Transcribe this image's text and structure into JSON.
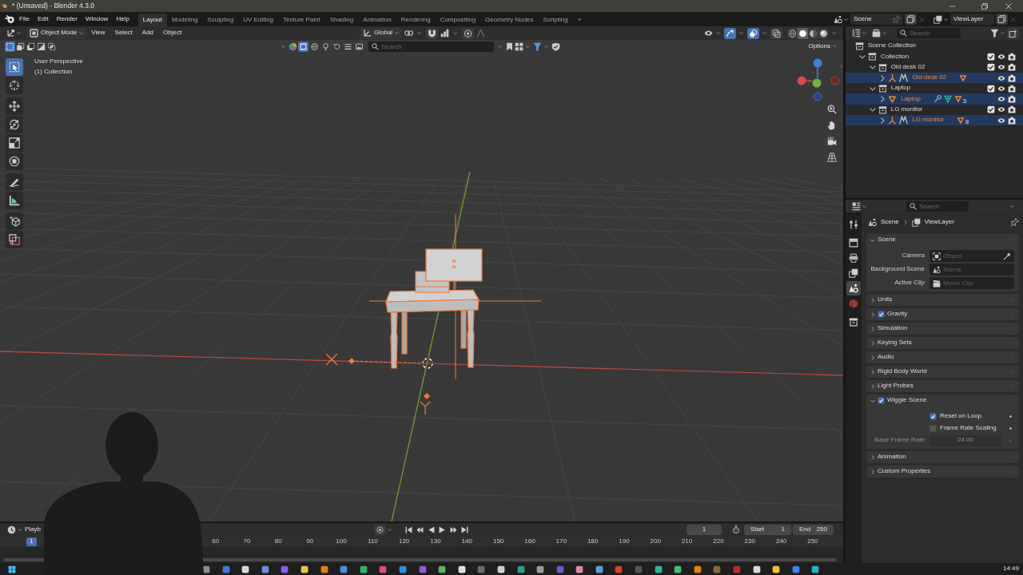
{
  "window": {
    "title": "* (Unsaved) - Blender 4.3.0"
  },
  "menu": [
    "File",
    "Edit",
    "Render",
    "Window",
    "Help"
  ],
  "workspaces": [
    {
      "label": "Layout",
      "selected": true
    },
    {
      "label": "Modeling",
      "selected": false
    },
    {
      "label": "Sculpting",
      "selected": false
    },
    {
      "label": "UV Editing",
      "selected": false
    },
    {
      "label": "Texture Paint",
      "selected": false
    },
    {
      "label": "Shading",
      "selected": false
    },
    {
      "label": "Animation",
      "selected": false
    },
    {
      "label": "Rendering",
      "selected": false
    },
    {
      "label": "Compositing",
      "selected": false
    },
    {
      "label": "Geometry Nodes",
      "selected": false
    },
    {
      "label": "Scripting",
      "selected": false
    }
  ],
  "add_workspace": "+",
  "scene_selector": {
    "scene": "Scene",
    "view_layer": "ViewLayer"
  },
  "viewport": {
    "mode": "Object Mode",
    "menus": [
      "View",
      "Select",
      "Add",
      "Object"
    ],
    "orientation": "Global",
    "toggles": [
      {
        "kind": "gizmos",
        "on": true
      },
      {
        "kind": "overlays",
        "on": true
      },
      {
        "kind": "xray",
        "on": false
      }
    ],
    "shading": [
      {
        "kind": "wireframe",
        "selected": false
      },
      {
        "kind": "solid",
        "selected": true
      },
      {
        "kind": "material",
        "selected": false
      },
      {
        "kind": "rendered",
        "selected": false
      }
    ],
    "select_modes": [
      {
        "kind": "set",
        "selected": true
      },
      {
        "kind": "extend",
        "selected": false
      },
      {
        "kind": "subtract",
        "selected": false
      },
      {
        "kind": "invert",
        "selected": false
      },
      {
        "kind": "intersect",
        "selected": false
      }
    ],
    "object_filters": [
      {
        "kind": "box",
        "selected": true
      },
      {
        "kind": "sphere",
        "selected": false
      },
      {
        "kind": "light",
        "selected": false
      },
      {
        "kind": "curve",
        "selected": false
      },
      {
        "kind": "group",
        "selected": false
      },
      {
        "kind": "image",
        "selected": false
      }
    ],
    "search": {
      "placeholder": "Search"
    },
    "options": "Options",
    "info": [
      "User Perspective",
      "(1) Collection"
    ],
    "tool_groups": [
      [
        {
          "kind": "select_box",
          "selected": true
        },
        {
          "kind": "cursor",
          "selected": false
        }
      ],
      [
        {
          "kind": "move",
          "selected": false
        },
        {
          "kind": "rotate",
          "selected": false
        },
        {
          "kind": "scale",
          "selected": false
        },
        {
          "kind": "transform",
          "selected": false
        }
      ],
      [
        {
          "kind": "annotate",
          "selected": false
        },
        {
          "kind": "measure",
          "selected": false
        }
      ],
      [
        {
          "kind": "add_cube",
          "selected": false
        },
        {
          "kind": "cube_tool",
          "selected": false
        }
      ]
    ]
  },
  "outliner": {
    "search": {
      "placeholder": "Search"
    },
    "tree": [
      {
        "label": "Scene Collection",
        "kind": "scene_collection",
        "selected": false,
        "children": [
          {
            "label": "Collection",
            "kind": "collection",
            "selected": false,
            "expanded": true,
            "checked": true,
            "children": [
              {
                "label": "Old desk 02",
                "kind": "collection",
                "selected": false,
                "expanded": true,
                "checked": true,
                "children": [
                  {
                    "label": "Old desk 02",
                    "kind": "empty",
                    "selected": true,
                    "expanded": false,
                    "data": [
                      {
                        "kind": "mesh"
                      }
                    ]
                  }
                ]
              },
              {
                "label": "Laptop",
                "kind": "collection",
                "selected": false,
                "expanded": true,
                "checked": true,
                "children": [
                  {
                    "label": "Laptop",
                    "kind": "mesh",
                    "selected": true,
                    "expanded": false,
                    "data": [
                      {
                        "kind": "modifier"
                      },
                      {
                        "kind": "vertex_groups"
                      },
                      {
                        "kind": "mesh",
                        "count": "3"
                      }
                    ]
                  }
                ]
              },
              {
                "label": "LG monitor",
                "kind": "collection",
                "selected": false,
                "expanded": true,
                "checked": true,
                "children": [
                  {
                    "label": "LG monitor",
                    "kind": "empty",
                    "selected": true,
                    "expanded": false,
                    "data": [
                      {
                        "kind": "mesh",
                        "count": "8"
                      }
                    ]
                  }
                ]
              }
            ]
          }
        ]
      }
    ]
  },
  "properties": {
    "search": {
      "placeholder": "Search"
    },
    "tab_groups": [
      [
        {
          "kind": "tool",
          "selected": false
        }
      ],
      [
        {
          "kind": "render",
          "selected": false
        },
        {
          "kind": "output",
          "selected": false
        },
        {
          "kind": "view_layer",
          "selected": false
        },
        {
          "kind": "scene",
          "selected": true
        },
        {
          "kind": "world",
          "selected": false
        }
      ],
      [
        {
          "kind": "collection",
          "selected": false
        }
      ]
    ],
    "breadcrumb": [
      "Scene",
      "ViewLayer"
    ],
    "panels": [
      {
        "title": "Scene",
        "kind": "plain",
        "expanded": true,
        "fields": [
          {
            "label": "Camera",
            "kind": "object",
            "placeholder": "Object",
            "disabled": false
          },
          {
            "label": "Background Scene",
            "kind": "scene",
            "placeholder": "Scene",
            "disabled": false
          },
          {
            "label": "Active Clip",
            "kind": "clip",
            "placeholder": "Movie Clip",
            "disabled": false
          }
        ]
      },
      {
        "title": "Units",
        "kind": "plain",
        "expanded": false
      },
      {
        "title": "Gravity",
        "kind": "toggle",
        "checked": true,
        "expanded": false
      },
      {
        "title": "Simulation",
        "kind": "plain",
        "expanded": false
      },
      {
        "title": "Keying Sets",
        "kind": "plain",
        "expanded": false
      },
      {
        "title": "Audio",
        "kind": "plain",
        "expanded": false
      },
      {
        "title": "Rigid Body World",
        "kind": "plain",
        "expanded": false
      },
      {
        "title": "Light Probes",
        "kind": "plain",
        "expanded": false
      },
      {
        "title": "Wiggle Scene",
        "kind": "toggle",
        "checked": true,
        "expanded": true,
        "options": [
          {
            "label": "Reset on Loop",
            "checked": true
          },
          {
            "label": "Frame Rate Scaling",
            "checked": false
          }
        ],
        "fields": [
          {
            "label": "Base Frame Rate",
            "kind": "number",
            "value": "24.00",
            "disabled": true
          }
        ]
      },
      {
        "title": "Animation",
        "kind": "plain",
        "expanded": false
      },
      {
        "title": "Custom Properties",
        "kind": "plain",
        "expanded": false
      }
    ]
  },
  "timeline": {
    "menu": "Playb",
    "frame": "1",
    "start": {
      "label": "Start",
      "value": "1"
    },
    "end": {
      "label": "End",
      "value": "250"
    },
    "playhead": "1",
    "ruler": [
      "60",
      "70",
      "80",
      "90",
      "100",
      "110",
      "120",
      "130",
      "140",
      "150",
      "160",
      "170",
      "180",
      "190",
      "200",
      "210",
      "220",
      "230",
      "240",
      "250"
    ]
  },
  "taskbar": {
    "time": "14:49"
  }
}
